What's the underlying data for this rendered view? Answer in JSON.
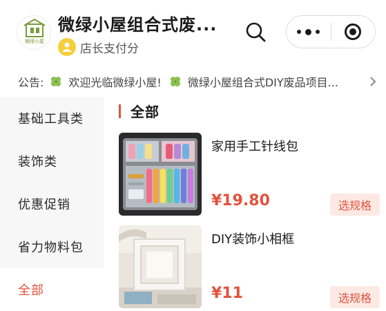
{
  "header": {
    "title": "微绿小屋组合式废...",
    "shop_subtitle": "店长支付分",
    "logo_text": "微绿小屋",
    "icons": {
      "search": "search-icon",
      "more": "more-dots-icon",
      "close": "close-circle-icon"
    }
  },
  "notice": {
    "label": "公告:",
    "items": [
      "欢迎光临微绿小屋!",
      "微绿小屋组合式DIY废品项目..."
    ],
    "icon": "clover-icon"
  },
  "sidebar": {
    "items": [
      {
        "label": "基础工具类"
      },
      {
        "label": "装饰类"
      },
      {
        "label": "优惠促销"
      },
      {
        "label": "省力物料包"
      },
      {
        "label": "全部"
      }
    ],
    "active_index": 4
  },
  "content": {
    "category_title": "全部",
    "products": [
      {
        "name": "家用手工针线包",
        "price": "¥19.80",
        "spec_label": "选规格"
      },
      {
        "name": "DIY装饰小相框",
        "price": "¥11",
        "spec_label": "选规格"
      }
    ]
  },
  "colors": {
    "accent": "#e0533f",
    "accent_bg": "#fde9e4",
    "sidebar_bg": "#f7f7f7",
    "badge": "#f4cf3a"
  }
}
